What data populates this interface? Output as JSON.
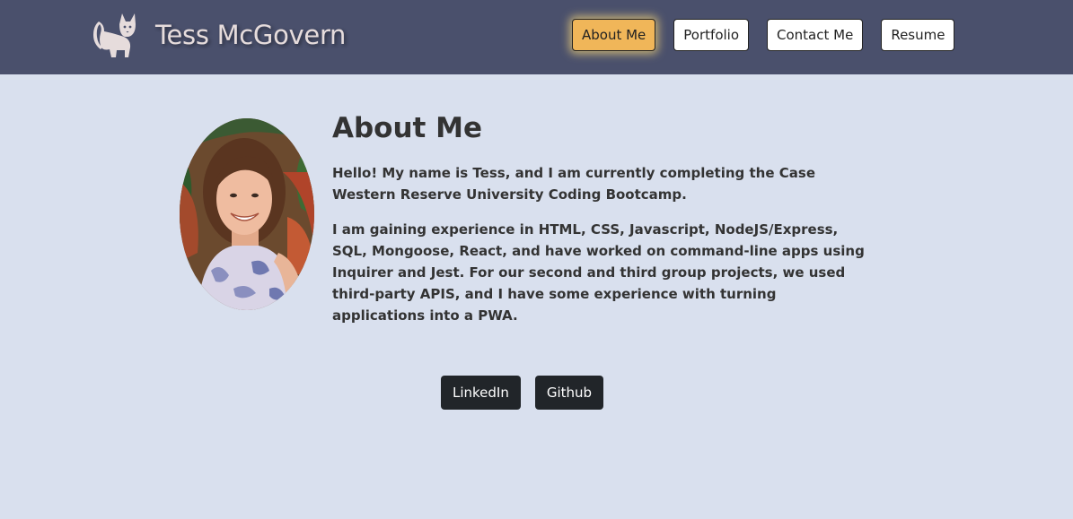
{
  "header": {
    "brand_name": "Tess McGovern",
    "logo_icon": "cat-icon",
    "nav": [
      {
        "label": "About Me",
        "active": true
      },
      {
        "label": "Portfolio",
        "active": false
      },
      {
        "label": "Contact Me",
        "active": false
      },
      {
        "label": "Resume",
        "active": false
      }
    ]
  },
  "about": {
    "title": "About Me",
    "paragraphs": [
      "Hello! My name is Tess, and I am currently completing the Case Western Reserve University Coding Bootcamp.",
      "I am gaining experience in HTML, CSS, Javascript, NodeJS/Express, SQL, Mongoose, React, and have worked on command-line apps using Inquirer and Jest. For our second and third group projects, we used third-party APIS, and I have some experience with turning applications into a PWA."
    ]
  },
  "links": {
    "linkedin": "LinkedIn",
    "github": "Github"
  },
  "colors": {
    "header_bg": "#4a506c",
    "page_bg": "#d9e0ee",
    "active_nav": "#f0b659",
    "link_button_bg": "#212529"
  }
}
